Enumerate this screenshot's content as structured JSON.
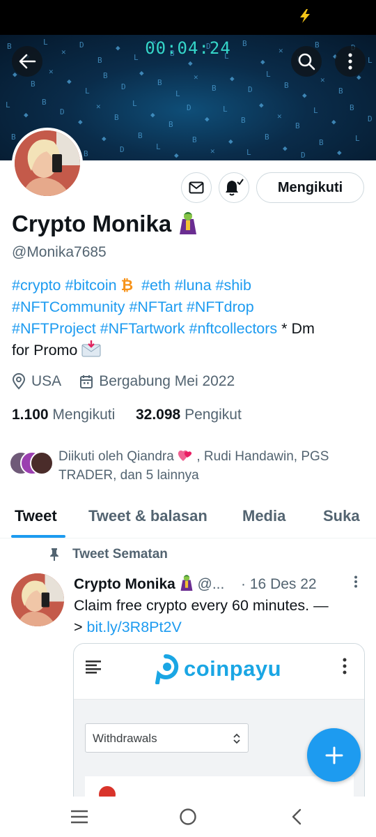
{
  "status_bar": {
    "icon": "lightning-bolt-icon",
    "icon_color": "#f5c518"
  },
  "banner": {
    "timer": "00:04:24",
    "colors": {
      "bg": "#0a2c4a",
      "glyph": "#4fa3d8"
    },
    "back_icon": "arrow-left-icon",
    "search_icon": "search-icon",
    "more_icon": "more-vertical-icon"
  },
  "profile": {
    "display_name": "Crypto Monika",
    "name_emoji": "🦹",
    "handle": "@Monika7685",
    "follow_button": "Mengikuti",
    "mail_icon": "mail-icon",
    "bell_icon": "bell-subscribed-icon",
    "bio": {
      "line1": [
        "#crypto",
        "#bitcoin",
        "₿",
        "#eth",
        "#luna",
        "#shib"
      ],
      "line2": [
        "#NFTCommunity",
        "#NFTart",
        "#NFTdrop"
      ],
      "line3": [
        "#NFTProject",
        "#NFTartwork",
        "#nftcollectors"
      ],
      "line3_tail": "* Dm",
      "line4_text": "for Promo",
      "line4_emoji": "📩"
    },
    "location": "USA",
    "joined": "Bergabung Mei 2022",
    "following_count": "1.100",
    "following_label": "Mengikuti",
    "followers_count": "32.098",
    "followers_label": "Pengikut",
    "followed_by_prefix": "Diikuti oleh Qiandra",
    "followed_by_emoji": "💕",
    "followed_by_rest": ", Rudi Handawin, PGS TRADER, dan 5 lainnya"
  },
  "tabs": [
    {
      "label": "Tweet",
      "active": true
    },
    {
      "label": "Tweet & balasan",
      "active": false
    },
    {
      "label": "Media",
      "active": false
    },
    {
      "label": "Suka",
      "active": false
    }
  ],
  "tweet": {
    "pinned_label": "Tweet Sematan",
    "author": "Crypto Monika",
    "author_emoji": "🦹",
    "handle_truncated": "@...",
    "date": "· 16 Des 22",
    "text_line1": "Claim free crypto every 60 minutes. —",
    "text_line2_prefix": ">",
    "link": "bit.ly/3R8Pt2V"
  },
  "card": {
    "brand": "coinpayu",
    "brand_color": "#1aa6e4",
    "select_value": "Withdrawals"
  },
  "fab": {
    "icon": "plus-icon",
    "color": "#1d9bf0"
  },
  "nav": {
    "recent_icon": "recent-apps-icon",
    "home_icon": "home-circle-icon",
    "back_icon": "back-chevron-icon"
  }
}
